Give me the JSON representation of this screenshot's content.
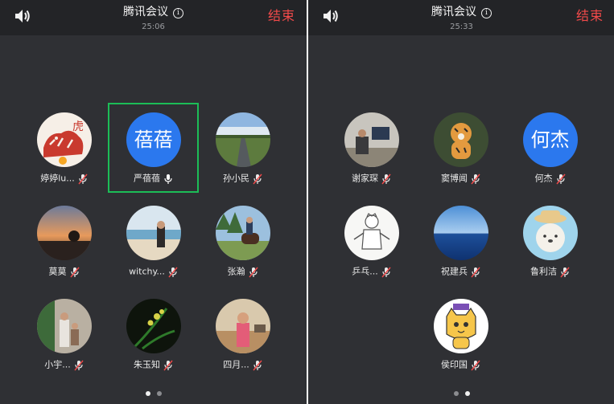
{
  "panels": [
    {
      "title": "腾讯会议",
      "timer": "25:06",
      "end_label": "结束",
      "page_dots": {
        "count": 2,
        "active": 0
      },
      "participants": [
        {
          "name": "婷婷lu...",
          "avatar": "paper-cut-tiger-photo",
          "mic": "muted"
        },
        {
          "name": "严蓓蓓",
          "avatar_text": "蓓蓓",
          "mic": "on",
          "active_speaker": true
        },
        {
          "name": "孙小民",
          "avatar": "road-landscape-photo",
          "mic": "muted"
        },
        {
          "name": "莫莫",
          "avatar": "sunset-photo",
          "mic": "muted"
        },
        {
          "name": "witchy...",
          "avatar": "beach-photo",
          "mic": "muted"
        },
        {
          "name": "张瀚",
          "avatar": "horse-rider-photo",
          "mic": "muted"
        },
        {
          "name": "小宇...",
          "avatar": "family-photo",
          "mic": "muted"
        },
        {
          "name": "朱玉知",
          "avatar": "orchid-photo",
          "mic": "muted"
        },
        {
          "name": "四月...",
          "avatar": "child-photo",
          "mic": "muted"
        }
      ]
    },
    {
      "title": "腾讯会议",
      "timer": "25:33",
      "end_label": "结束",
      "page_dots": {
        "count": 2,
        "active": 1
      },
      "participants": [
        {
          "name": "谢家琛",
          "avatar": "office-desk-photo",
          "mic": "muted"
        },
        {
          "name": "窦博闻",
          "avatar": "tiger-toy-photo",
          "mic": "muted"
        },
        {
          "name": "何杰",
          "avatar_text": "何杰",
          "mic": "muted"
        },
        {
          "name": "乒乓...",
          "avatar": "cartoon-taichi-drawing",
          "mic": "muted"
        },
        {
          "name": "祝建兵",
          "avatar": "ocean-photo",
          "mic": "muted"
        },
        {
          "name": "鲁利洁",
          "avatar": "cartoon-bear-drawing",
          "mic": "muted"
        },
        {
          "name": "侯印国",
          "avatar": "cartoon-cat-drawing",
          "mic": "muted"
        }
      ]
    }
  ],
  "colors": {
    "end": "#f24a4a",
    "active_border": "#1cbd57",
    "text_avatar": "#2b78ee"
  }
}
